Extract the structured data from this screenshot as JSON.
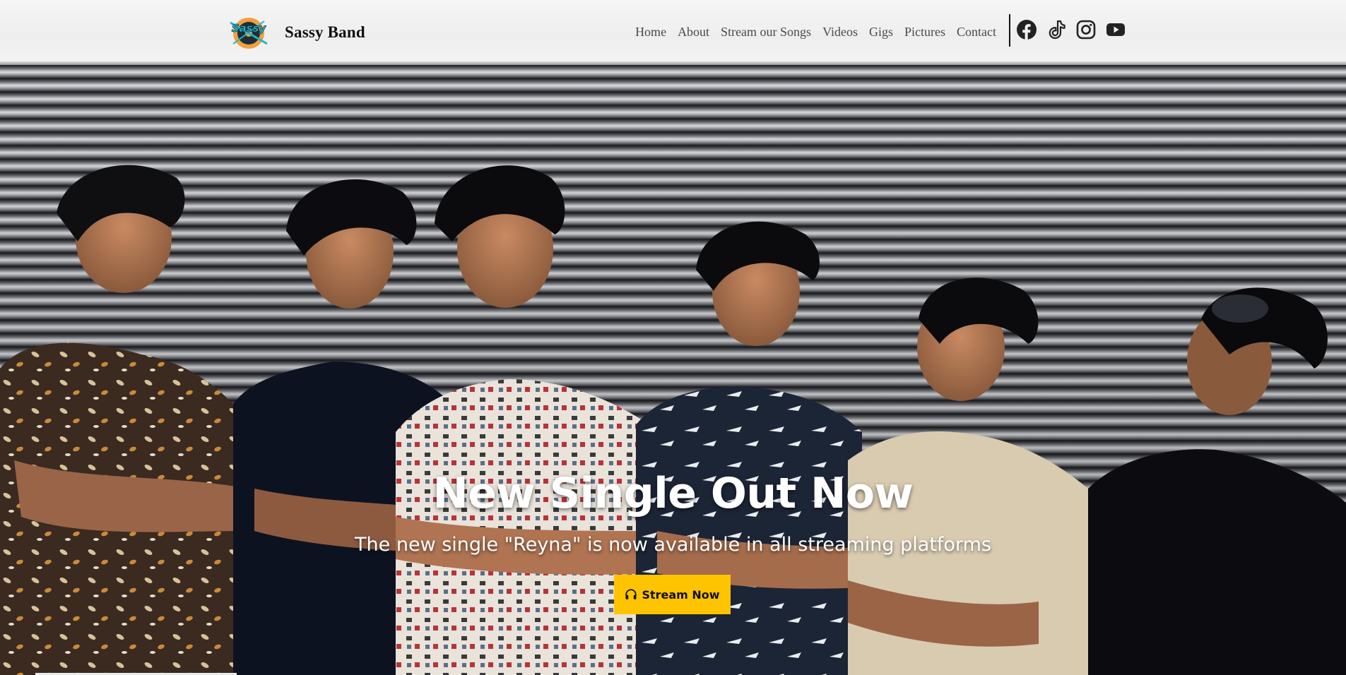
{
  "header": {
    "brand": "Sassy Band",
    "logo_text": "Sassy",
    "nav": [
      {
        "label": "Home"
      },
      {
        "label": "About"
      },
      {
        "label": "Stream our Songs"
      },
      {
        "label": "Videos"
      },
      {
        "label": "Gigs"
      },
      {
        "label": "Pictures"
      },
      {
        "label": "Contact"
      }
    ],
    "socials": [
      "facebook-icon",
      "tiktok-icon",
      "instagram-icon",
      "youtube-icon"
    ]
  },
  "hero": {
    "title": "New Single Out Now",
    "subtitle": "The new single \"Reyna\" is now available in all streaming platforms",
    "cta_label": "Stream Now",
    "cta_icon": "headphones-icon"
  },
  "colors": {
    "accent": "#ffc400",
    "header_bg": "#f1f1f1",
    "nav_text": "#4a4a4a"
  }
}
